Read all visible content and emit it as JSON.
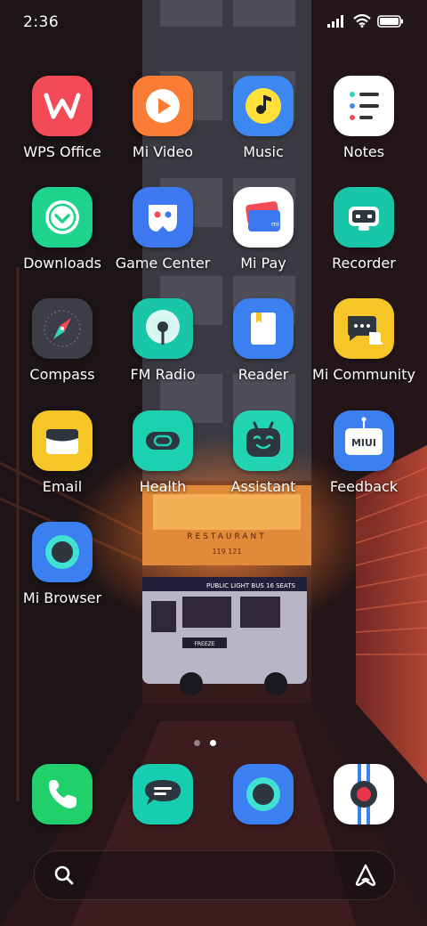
{
  "status_bar": {
    "time": "2:36",
    "icons": [
      "signal-icon",
      "wifi-icon",
      "battery-icon"
    ]
  },
  "apps": [
    {
      "label": "WPS Office",
      "icon": "wps-office-icon"
    },
    {
      "label": "Mi Video",
      "icon": "mi-video-icon"
    },
    {
      "label": "Music",
      "icon": "music-icon"
    },
    {
      "label": "Notes",
      "icon": "notes-icon"
    },
    {
      "label": "Downloads",
      "icon": "downloads-icon"
    },
    {
      "label": "Game Center",
      "icon": "game-center-icon"
    },
    {
      "label": "Mi Pay",
      "icon": "mi-pay-icon"
    },
    {
      "label": "Recorder",
      "icon": "recorder-icon"
    },
    {
      "label": "Compass",
      "icon": "compass-icon"
    },
    {
      "label": "FM Radio",
      "icon": "fm-radio-icon"
    },
    {
      "label": "Reader",
      "icon": "reader-icon"
    },
    {
      "label": "Mi Community",
      "icon": "mi-community-icon"
    },
    {
      "label": "Email",
      "icon": "email-icon"
    },
    {
      "label": "Health",
      "icon": "health-icon"
    },
    {
      "label": "Assistant",
      "icon": "assistant-icon"
    },
    {
      "label": "Feedback",
      "icon": "feedback-icon",
      "badge_text": "MIUI"
    },
    {
      "label": "Mi Browser",
      "icon": "mi-browser-icon"
    }
  ],
  "page_indicator": {
    "pages": 2,
    "current": 2
  },
  "dock": [
    {
      "icon": "phone-icon"
    },
    {
      "icon": "messaging-icon"
    },
    {
      "icon": "browser-icon"
    },
    {
      "icon": "camera-icon"
    }
  ],
  "search_bar": {
    "left_icon": "search-icon",
    "right_icon": "assistant-icon"
  },
  "wallpaper": {
    "sign_text": "RESTAURANT",
    "sign_numbers": "119 121",
    "bus_text": "PUBLIC LIGHT BUS 16 SEATS",
    "bus_plate": "FREEZE"
  },
  "colors": {
    "wps": "#f34a58",
    "mivideo": "#fb7d35",
    "music": "#3d87f3",
    "notes": "#ffffff",
    "downloads": "#1ed38b",
    "gamecenter": "#3d78f0",
    "mipay": "#ffffff",
    "recorder": "#19c7a8",
    "compass": "#3d3d48",
    "fmradio": "#1ac6a8",
    "reader": "#3b7ff0",
    "community": "#f6c627",
    "email": "#f6c627",
    "health": "#1cd1b0",
    "assistant": "#22d4b0",
    "feedback": "#3b7ff0",
    "mibrowser": "#3b7ff0",
    "phone": "#21cf6b",
    "messaging": "#16cdb0",
    "camera_accent": "#e9334a"
  }
}
